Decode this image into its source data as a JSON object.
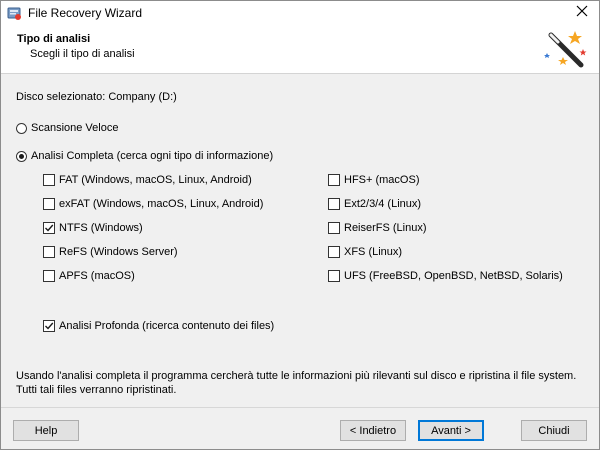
{
  "window": {
    "title": "File Recovery Wizard"
  },
  "header": {
    "title": "Tipo di analisi",
    "subtitle": "Scegli il tipo di analisi"
  },
  "disk": {
    "label": "Disco selezionato: Company (D:)"
  },
  "scan_options": {
    "quick_label": "Scansione Veloce",
    "quick_selected": false,
    "full_label": "Analisi Completa (cerca ogni tipo di informazione)",
    "full_selected": true
  },
  "filesystems": {
    "left": [
      {
        "label": "FAT (Windows, macOS, Linux, Android)",
        "checked": false
      },
      {
        "label": "exFAT (Windows, macOS, Linux, Android)",
        "checked": false
      },
      {
        "label": "NTFS (Windows)",
        "checked": true
      },
      {
        "label": "ReFS (Windows Server)",
        "checked": false
      },
      {
        "label": "APFS (macOS)",
        "checked": false
      }
    ],
    "right": [
      {
        "label": "HFS+ (macOS)",
        "checked": false
      },
      {
        "label": "Ext2/3/4 (Linux)",
        "checked": false
      },
      {
        "label": "ReiserFS (Linux)",
        "checked": false
      },
      {
        "label": "XFS (Linux)",
        "checked": false
      },
      {
        "label": "UFS (FreeBSD, OpenBSD, NetBSD, Solaris)",
        "checked": false
      }
    ]
  },
  "deep_scan": {
    "label": "Analisi Profonda (ricerca contenuto dei files)",
    "checked": true
  },
  "info_text": "Usando l'analisi completa il programma cercherà tutte le informazioni più rilevanti sul disco e ripristina il file system. Tutti tali files verranno ripristinati.",
  "buttons": {
    "help": "Help",
    "back": "< Indietro",
    "next": "Avanti >",
    "close": "Chiudi"
  },
  "icons": {
    "app": "file-recovery-app-icon",
    "close": "close-icon",
    "wizard": "magic-wand-icon"
  },
  "colors": {
    "default_button_border": "#0078d7"
  }
}
